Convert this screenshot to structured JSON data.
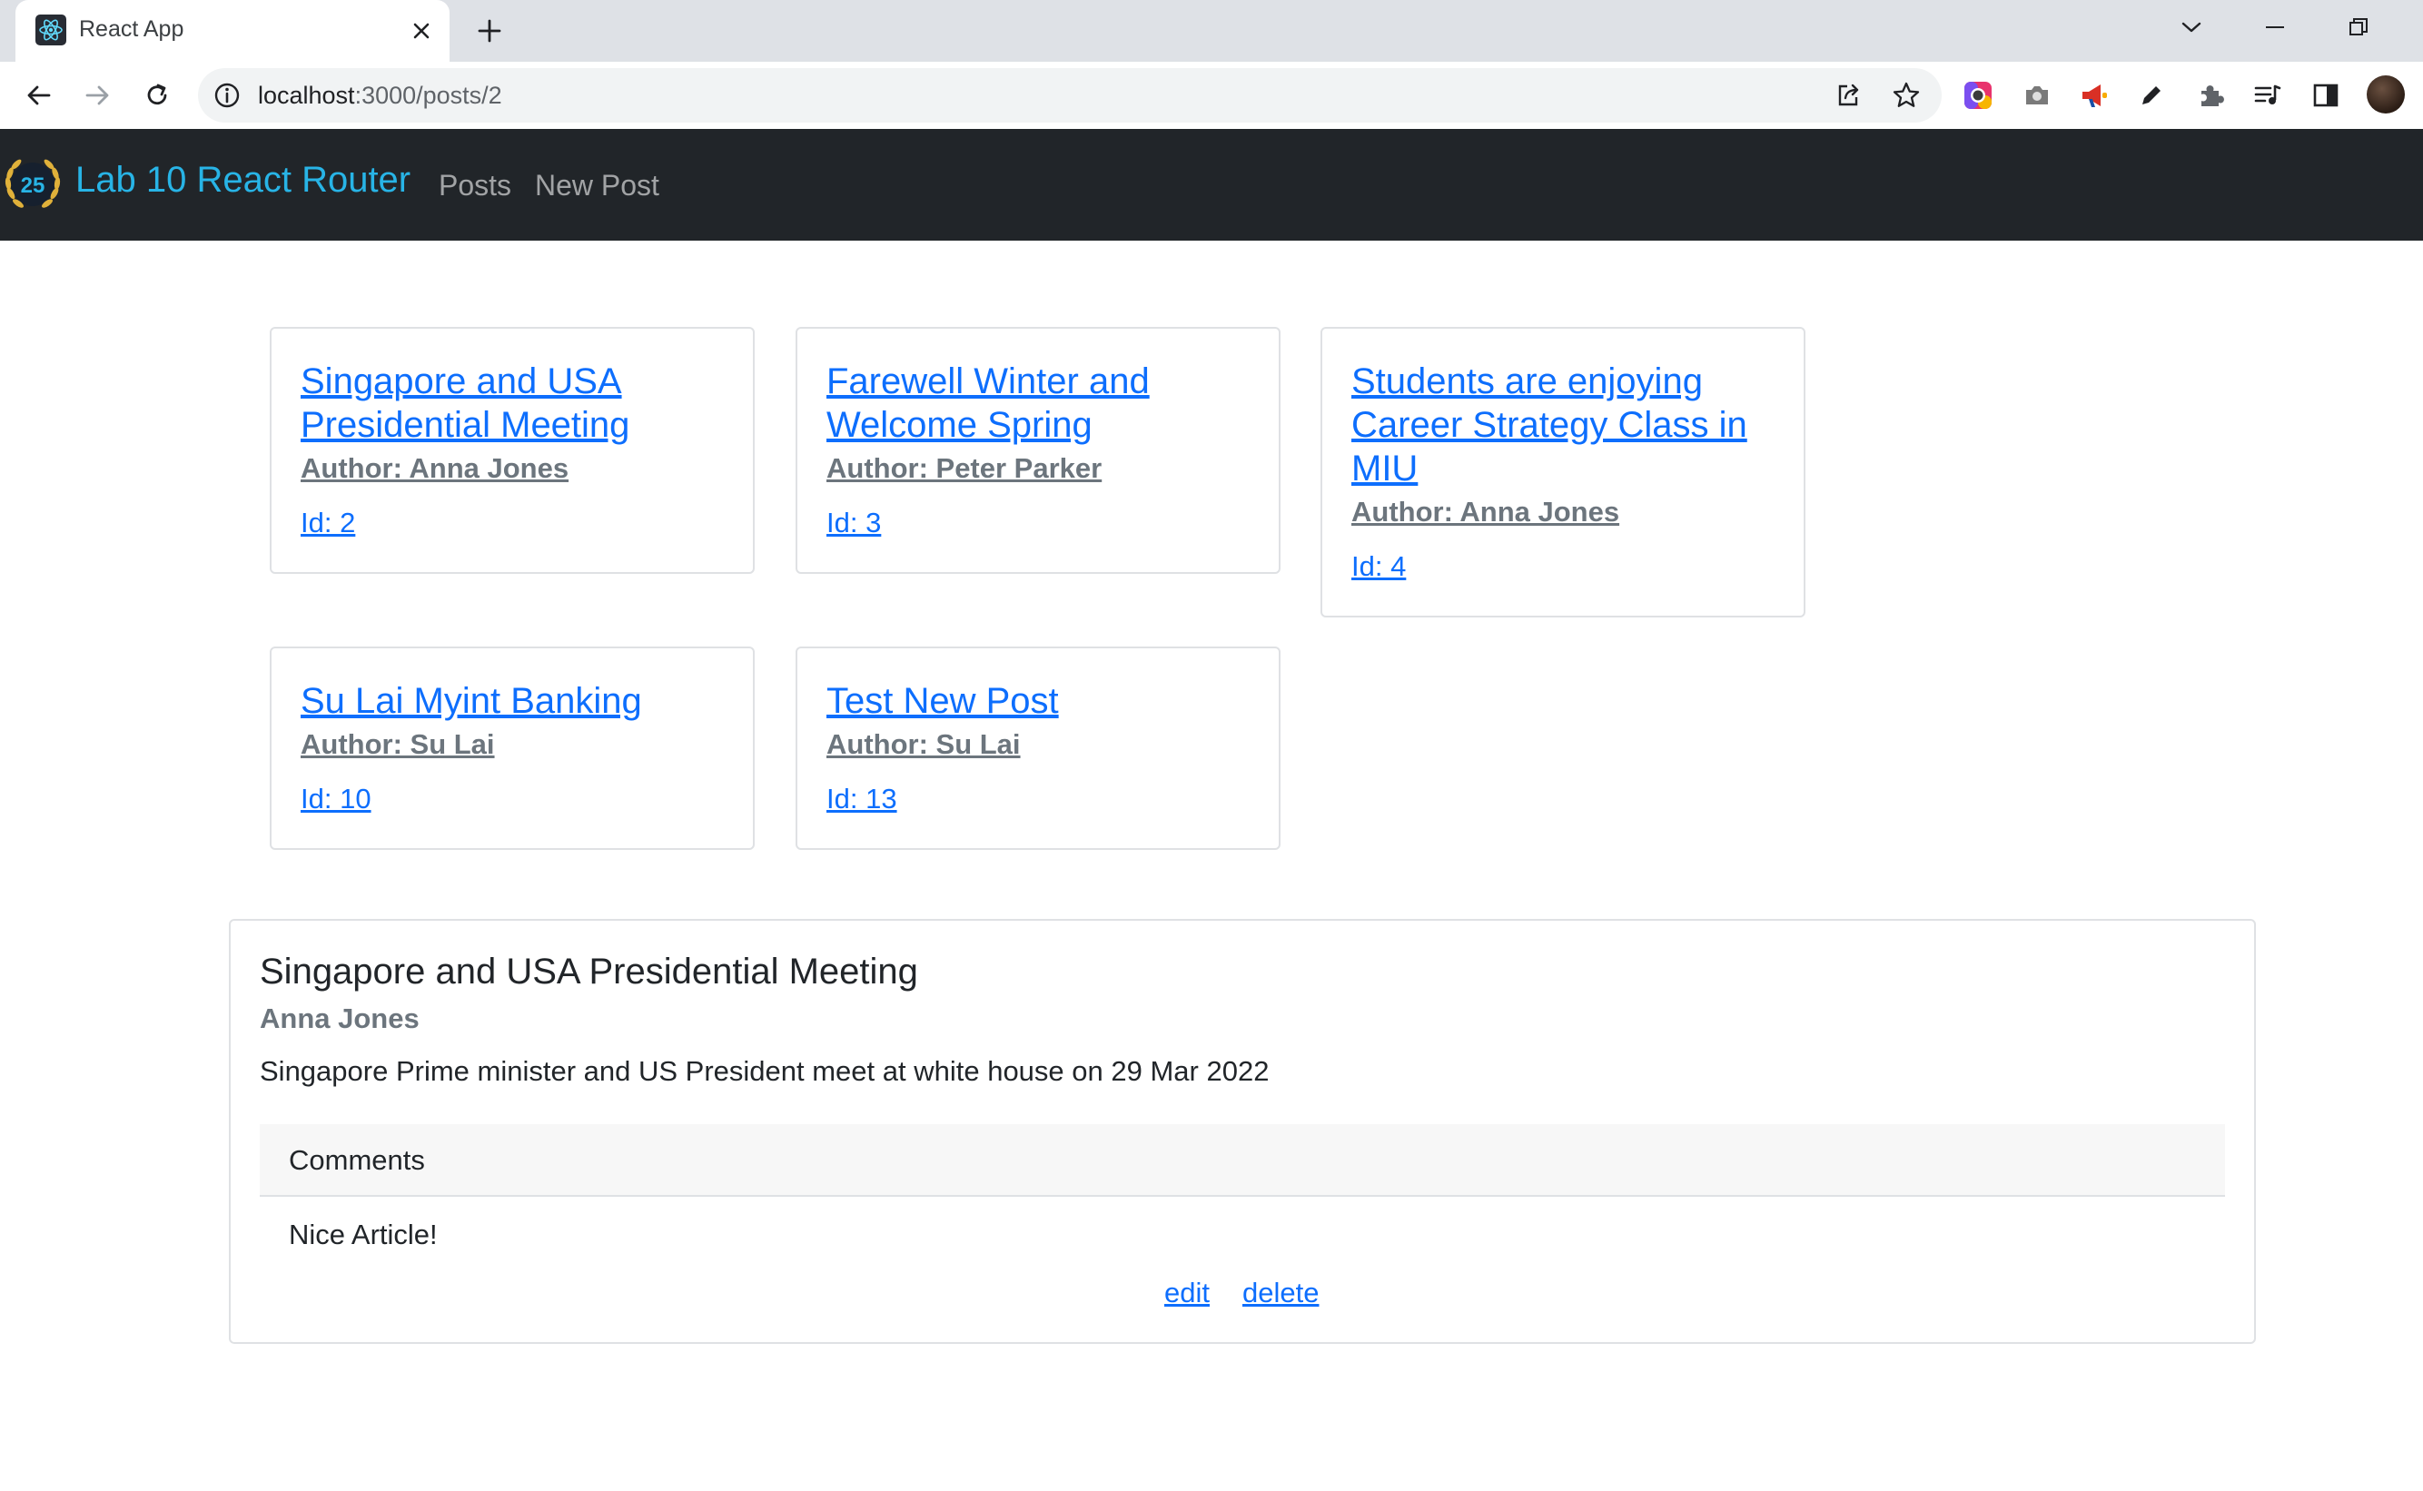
{
  "browser": {
    "tab_title": "React App",
    "url_host": "localhost",
    "url_path": ":3000/posts/2"
  },
  "navbar": {
    "brand": "Lab 10 React Router",
    "logo_badge": "25",
    "links": [
      "Posts",
      "New Post"
    ]
  },
  "posts": [
    {
      "title": "Singapore and USA Presidential Meeting",
      "author": "Author: Anna Jones",
      "id": "Id: 2"
    },
    {
      "title": "Farewell Winter and Welcome Spring",
      "author": "Author: Peter Parker",
      "id": "Id: 3"
    },
    {
      "title": "Students are enjoying Career Strategy Class in MIU",
      "author": "Author: Anna Jones",
      "id": "Id: 4"
    },
    {
      "title": "Su Lai Myint Banking",
      "author": "Author: Su Lai",
      "id": "Id: 10"
    },
    {
      "title": "Test New Post",
      "author": "Author: Su Lai",
      "id": "Id: 13"
    }
  ],
  "detail": {
    "title": "Singapore and USA Presidential Meeting",
    "author": "Anna Jones",
    "content": "Singapore Prime minister and US President meet at white house on 29 Mar 2022",
    "comments_header": "Comments",
    "comments": [
      "Nice Article!"
    ],
    "edit_label": "edit",
    "delete_label": "delete"
  },
  "colors": {
    "navbar_bg": "#212529",
    "brand": "#28b4e6",
    "link": "#0d6efd",
    "muted": "#6c757d"
  }
}
